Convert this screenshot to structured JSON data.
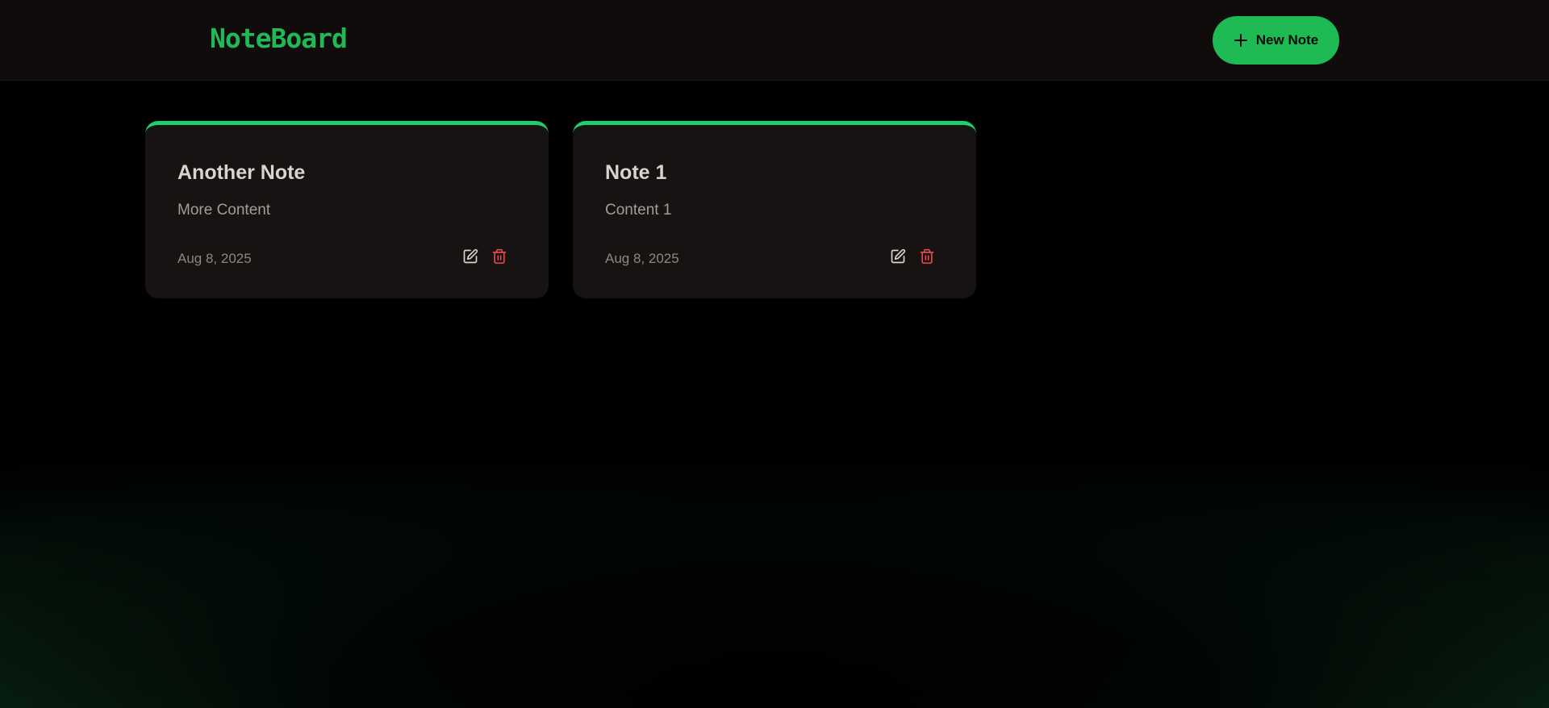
{
  "app": {
    "name": "NoteBoard"
  },
  "header": {
    "new_note_label": "New Note"
  },
  "notes": [
    {
      "title": "Another Note",
      "content": "More Content",
      "date": "Aug 8, 2025"
    },
    {
      "title": "Note 1",
      "content": "Content 1",
      "date": "Aug 8, 2025"
    }
  ],
  "icons": {
    "plus": "plus-icon",
    "edit": "edit-icon",
    "delete": "trash-icon"
  },
  "colors": {
    "accent": "#1ebb55",
    "card_top_border": "#1ed06a",
    "delete": "#e5484d",
    "background": "#000000",
    "header_bg": "#0f0c0b",
    "card_bg": "#161312"
  }
}
